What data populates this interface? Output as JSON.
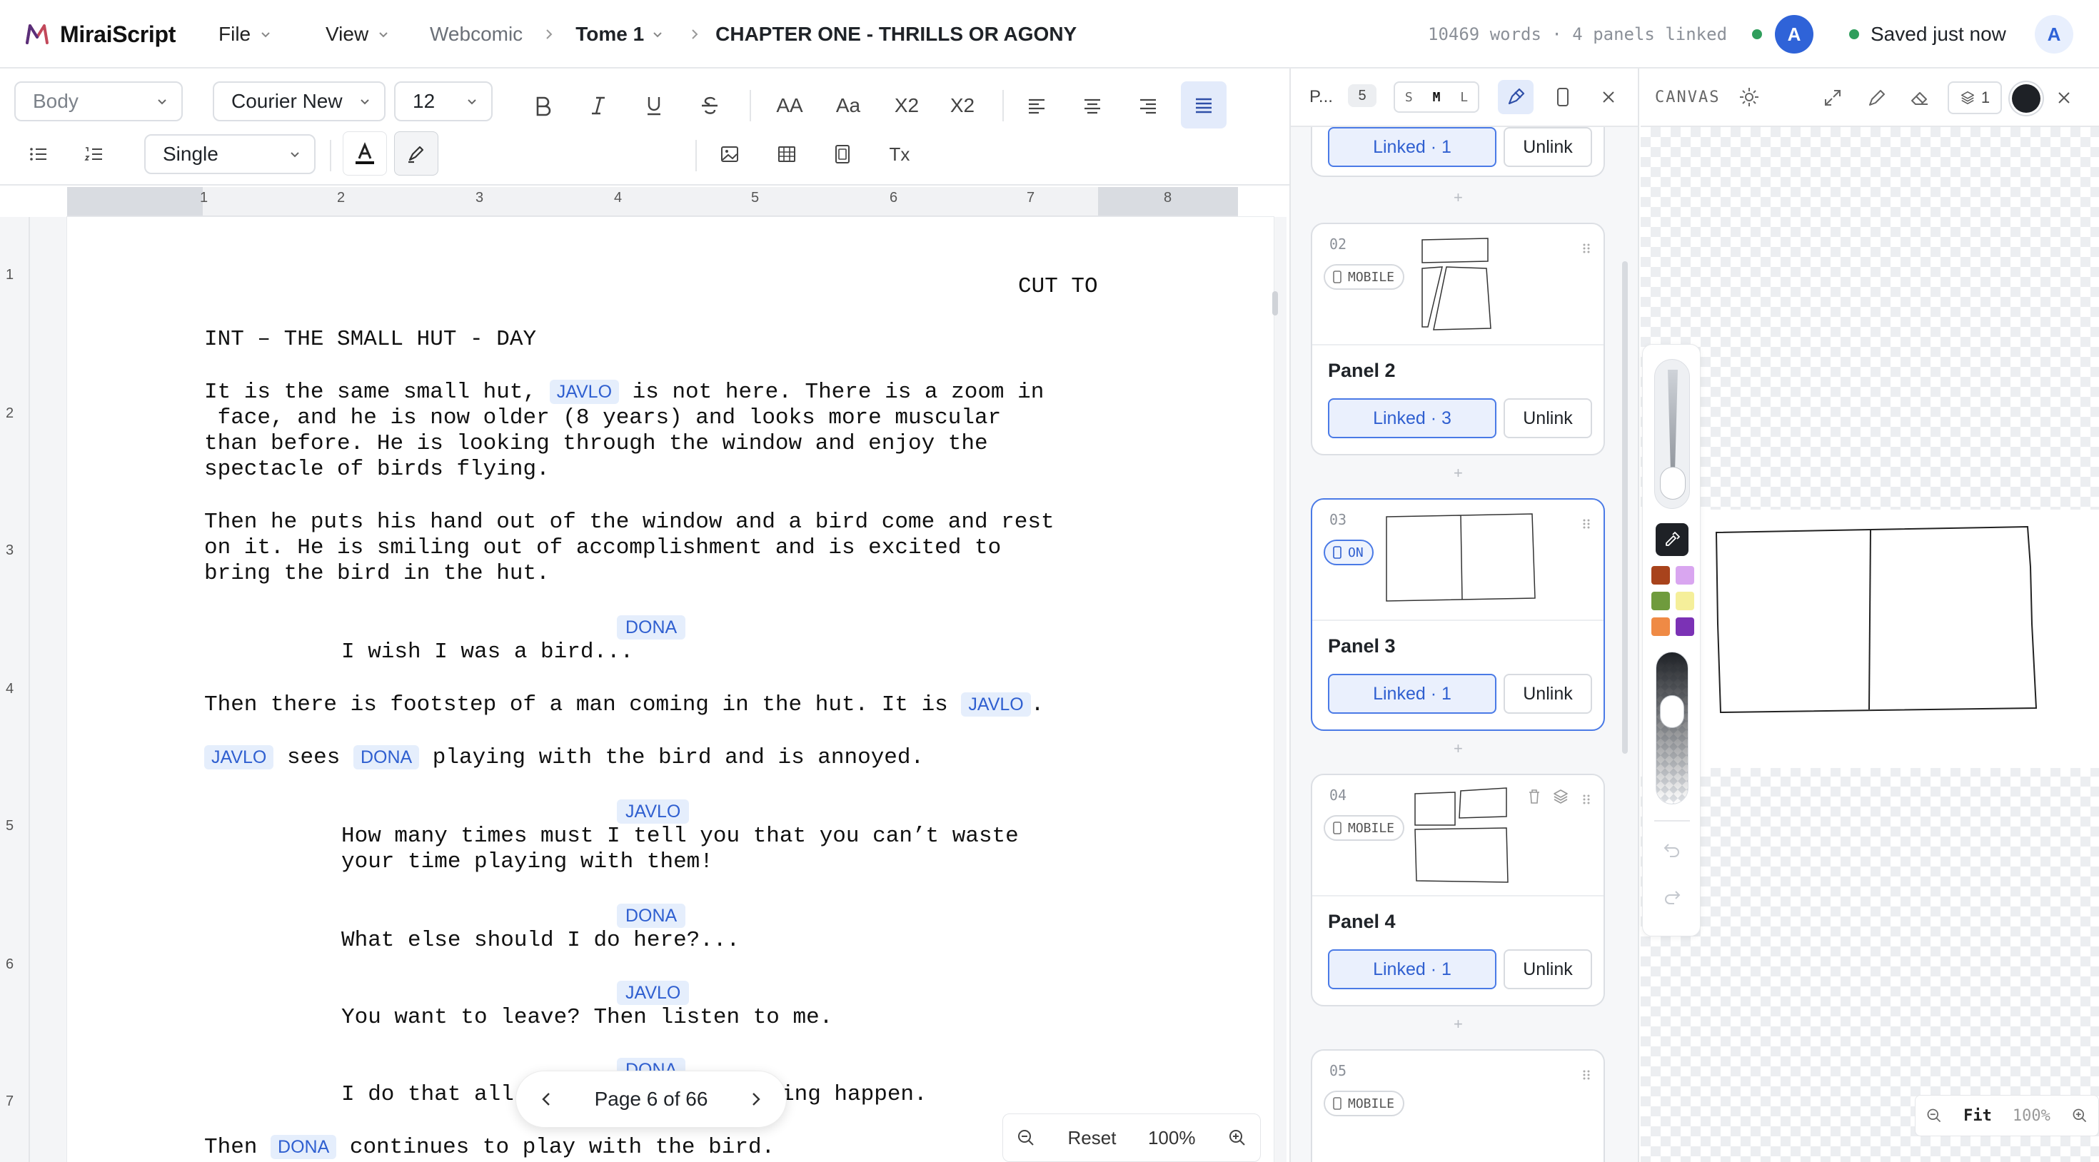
{
  "app": {
    "name": "MiraiScript"
  },
  "menus": {
    "file": "File",
    "view": "View"
  },
  "breadcrumb": {
    "root": "Webcomic",
    "tome": "Tome 1",
    "chapter": "CHAPTER ONE - THRILLS OR AGONY"
  },
  "status": {
    "stats": "10469 words · 4 panels linked",
    "user_initial": "A",
    "saved": "Saved just now",
    "user2_initial": "A"
  },
  "toolbar": {
    "style": "Body",
    "font": "Courier New",
    "size": "12",
    "spacing": "Single",
    "case_upper": "AA",
    "case_title": "Aa",
    "superscript": "X2",
    "subscript": "X2",
    "clear_format": "Tx",
    "highlight_colors": [
      "#f7f34a",
      "#5fd84a",
      "#5ee9ee",
      "#f04fd6",
      "#e8352b",
      "#1f2ad8",
      "#b8b8b8",
      "#8b8a22"
    ]
  },
  "ruler": {
    "marks": [
      "1",
      "2",
      "3",
      "4",
      "5",
      "6",
      "7",
      "8"
    ],
    "vmarks": [
      "1",
      "2",
      "3",
      "4",
      "5",
      "6",
      "7"
    ]
  },
  "script": {
    "transition": "CUT TO",
    "scene": "INT – THE SMALL HUT - DAY",
    "p1_a": "It is the same small hut, ",
    "p1_tag": "JAVLO",
    "p1_b": " is not here. There is a zoom in",
    "p1_l2": " face, and he is now older (8 years) and looks more muscular",
    "p1_l3": "than before. He is looking through the window and enjoy the",
    "p1_l4": "spectacle of birds flying.",
    "p2_l1": "Then he puts his hand out of the window and a bird come and rest",
    "p2_l2": "on it. He is smiling out of accomplishment and is excited to",
    "p2_l3": "bring the bird in the hut.",
    "c1": "DONA",
    "d1": "I wish I was a bird...",
    "p3_a": "Then there is footstep of a man coming in the hut. It is ",
    "p3_tag": "JAVLO",
    "p3_b": ".",
    "p4_tag1": "JAVLO",
    "p4_mid": " sees ",
    "p4_tag2": "DONA",
    "p4_end": " playing with the bird and is annoyed.",
    "c2": "JAVLO",
    "d2_l1": "How many times must I tell you that you can’t waste",
    "d2_l2": "your time playing with them!",
    "c3": "DONA",
    "d3": "What else should I do here?...",
    "c4": "JAVLO",
    "d4": "You want to leave? Then listen to me.",
    "c5": "DONA",
    "d5_a": "I do that all",
    "d5_b": "ing happen.",
    "p5_a": "Then ",
    "p5_tag": "DONA",
    "p5_b": " continues to play with the bird."
  },
  "pager": {
    "label": "Page 6 of 66"
  },
  "editor_zoom": {
    "reset": "Reset",
    "percent": "100%"
  },
  "panels": {
    "header_label": "P...",
    "count": "5",
    "sizes": [
      "S",
      "M",
      "L"
    ],
    "items": [
      {
        "link": "Linked · 1",
        "unlink": "Unlink"
      },
      {
        "num": "02",
        "chip": "MOBILE",
        "title": "Panel 2",
        "link": "Linked · 3",
        "unlink": "Unlink"
      },
      {
        "num": "03",
        "chip": "ON",
        "title": "Panel 3",
        "link": "Linked · 1",
        "unlink": "Unlink"
      },
      {
        "num": "04",
        "chip": "MOBILE",
        "title": "Panel 4",
        "link": "Linked · 1",
        "unlink": "Unlink"
      },
      {
        "num": "05",
        "chip": "MOBILE"
      }
    ]
  },
  "canvas": {
    "label": "CANVAS",
    "layers": "1",
    "colors": [
      "#a8431c",
      "#d9a6f0",
      "#6f9b3d",
      "#f5ef9a",
      "#ef8a45",
      "#7b32b5"
    ],
    "fit": "Fit",
    "zoom": "100%"
  }
}
